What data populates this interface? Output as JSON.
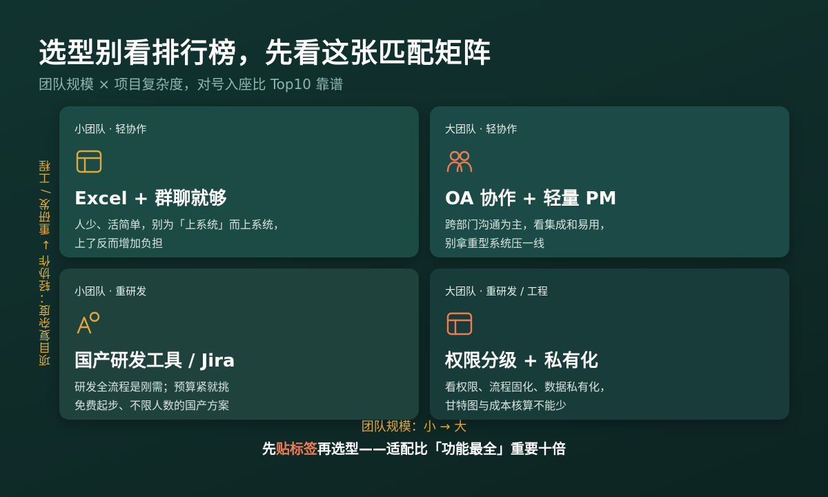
{
  "header": {
    "title": "选型别看排行榜，先看这张匹配矩阵",
    "subtitle": "团队规模 × 项目复杂度，对号入座比 Top10 靠谱"
  },
  "axes": {
    "y_label": "项目复杂度：轻协作 → 重研发 / 工程",
    "x_label": "团队规模：小 → 大"
  },
  "cards": [
    {
      "tag": "小团队 · 轻协作",
      "icon": "table-icon",
      "heading": "Excel + 群聊就够",
      "lines": [
        "人少、活简单，别为「上系统」而上系统，",
        "上了反而增加负担"
      ]
    },
    {
      "tag": "大团队 · 轻协作",
      "icon": "users-icon",
      "heading": "OA 协作 + 轻量 PM",
      "lines": [
        "跨部门沟通为主，看集成和易用，",
        "别拿重型系统压一线"
      ]
    },
    {
      "tag": "小团队 · 重研发",
      "icon": "shapes-icon",
      "heading": "国产研发工具 / Jira",
      "lines": [
        "研发全流程是刚需；预算紧就挑",
        "免费起步、不限人数的国产方案"
      ]
    },
    {
      "tag": "大团队 · 重研发 / 工程",
      "icon": "table-icon",
      "heading": "权限分级 + 私有化",
      "lines": [
        "看权限、流程固化、数据私有化，",
        "甘特图与成本核算不能少"
      ]
    }
  ],
  "footer": {
    "prefix": "先",
    "highlight": "贴标签",
    "suffix": "再选型——适配比「功能最全」重要十倍"
  },
  "colors": {
    "accent_gold": "#e0a93c",
    "accent_coral": "#ee7d55",
    "background": "#0f2b28"
  }
}
